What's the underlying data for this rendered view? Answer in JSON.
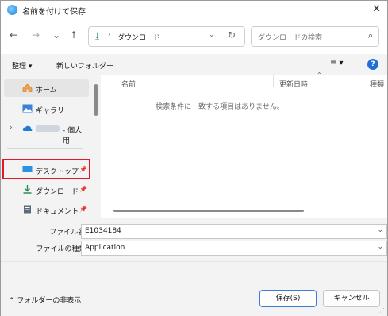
{
  "window": {
    "title": "名前を付けて保存",
    "close_glyph": "✕"
  },
  "nav": {
    "back": "←",
    "forward": "→",
    "recent": "⌄",
    "up": "↑",
    "address": {
      "separator": "›",
      "location": "ダウンロード",
      "dropdown": "⌄",
      "refresh": "↻"
    },
    "search_placeholder": "ダウンロードの検索",
    "search_icon": "⌕"
  },
  "toolbar": {
    "organize": "整理 ▾",
    "new_folder": "新しいフォルダー",
    "view": "≡ ▾",
    "help": "?"
  },
  "sidebar": {
    "home": "ホーム",
    "gallery": "ギャラリー",
    "onedrive": "- 個人用",
    "onedrive_expander": "›",
    "desktop": "デスクトップ",
    "downloads": "ダウンロード",
    "documents": "ドキュメント",
    "pin": "📌"
  },
  "filelist": {
    "col_name": "名前",
    "col_modified": "更新日時",
    "col_type": "種類",
    "sort_indicator": "⌃",
    "empty_message": "検索条件に一致する項目はありません。"
  },
  "form": {
    "filename_label": "ファイル名(N):",
    "filename_value": "E1034184",
    "filetype_label": "ファイルの種類(T):",
    "filetype_value": "Application",
    "dd": "⌄"
  },
  "footer": {
    "hide_folders": "⌃  フォルダーの非表示",
    "save": "保存(S)",
    "cancel": "キャンセル"
  },
  "colors": {
    "highlight_border": "#e0192a",
    "selected_item": "#e5e5e5",
    "accent": "#1f6fd6"
  }
}
